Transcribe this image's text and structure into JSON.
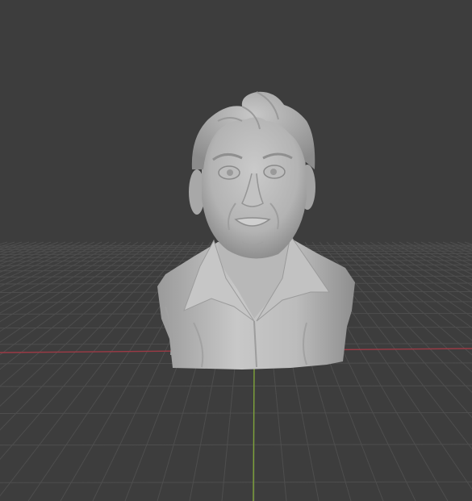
{
  "viewport": {
    "background_color": "#3d3d3d",
    "grid_line_color": "#4e4e4e",
    "x_axis_color": "#9b3a45",
    "y_axis_color": "#7ea33a",
    "object": {
      "name": "sculpted-bust",
      "material_color": "#b4b4b4"
    }
  }
}
